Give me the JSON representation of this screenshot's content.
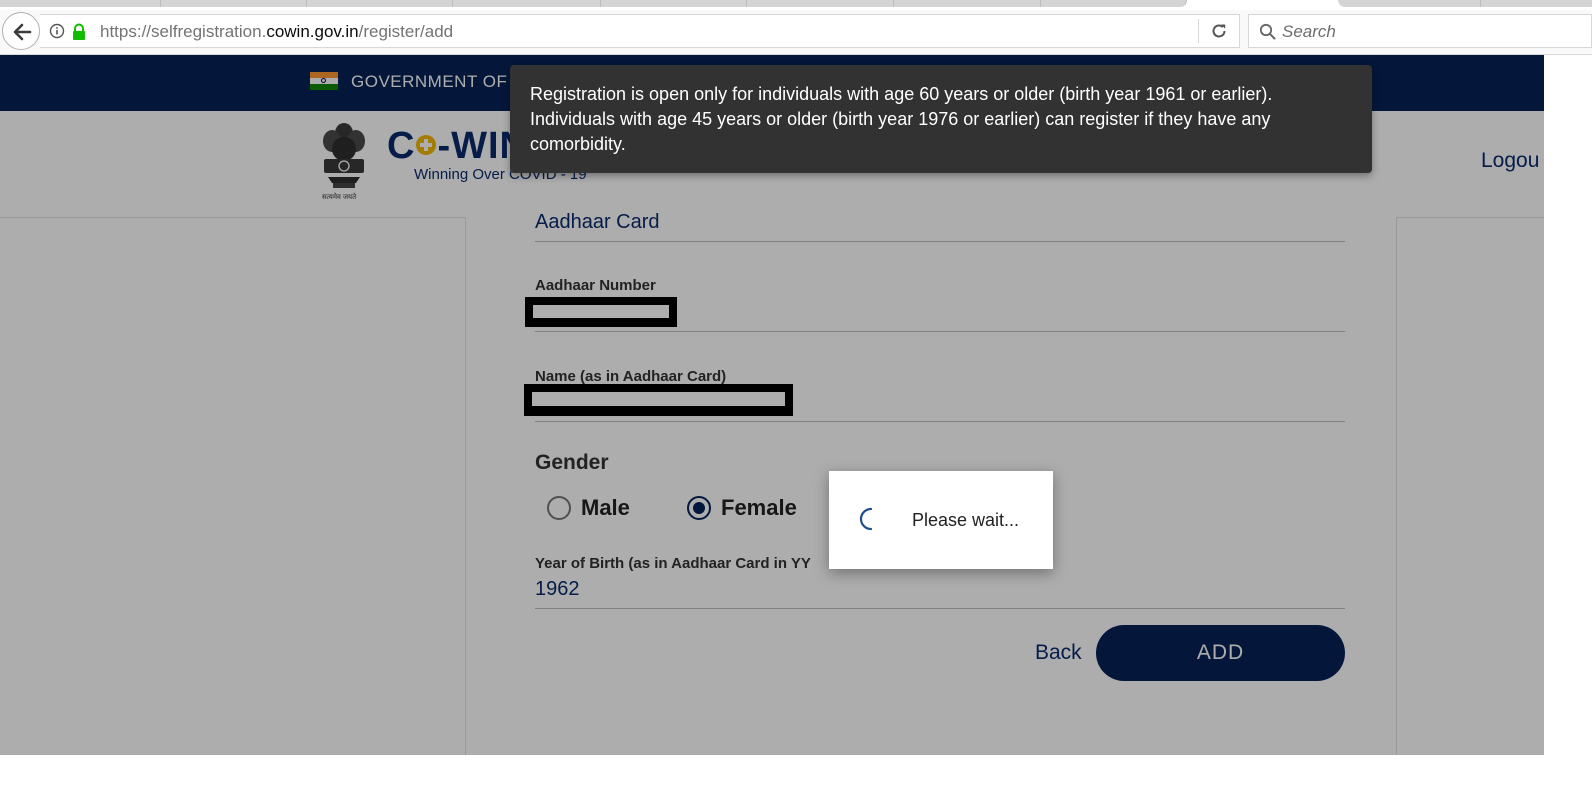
{
  "browser": {
    "url_prefix": "https://selfregistration.",
    "url_domain": "cowin.gov.in",
    "url_path": "/register/add",
    "search_placeholder": "Search"
  },
  "gov_bar": {
    "text": "GOVERNMENT OF"
  },
  "header": {
    "brand_left": "C",
    "brand_right": "-WIN",
    "tagline": "Winning Over COVID - 19",
    "emblem_caption": "सत्यमेव जयते",
    "logout": "Logou"
  },
  "form": {
    "id_type_value": "Aadhaar Card",
    "aadhaar_label": "Aadhaar Number",
    "name_label": "Name (as in Aadhaar Card)",
    "gender_label": "Gender",
    "gender_options": [
      {
        "label": "Male",
        "checked": false
      },
      {
        "label": "Female",
        "checked": true
      }
    ],
    "yob_label": "Year of Birth (as in Aadhaar Card in YY",
    "yob_value": "1962",
    "back_label": "Back",
    "add_label": "ADD"
  },
  "toast": {
    "line1": "Registration is open only for individuals with age 60 years or older (birth year 1961 or earlier).",
    "line2": "Individuals with age 45 years or older (birth year 1976 or earlier) can register if they have any",
    "line3": "comorbidity."
  },
  "loading_dialog": {
    "text": "Please wait..."
  },
  "colors": {
    "navy": "#062256",
    "brand_blue": "#0a2a6c",
    "toast_bg": "#323232",
    "brand_accent": "#f2b705"
  }
}
